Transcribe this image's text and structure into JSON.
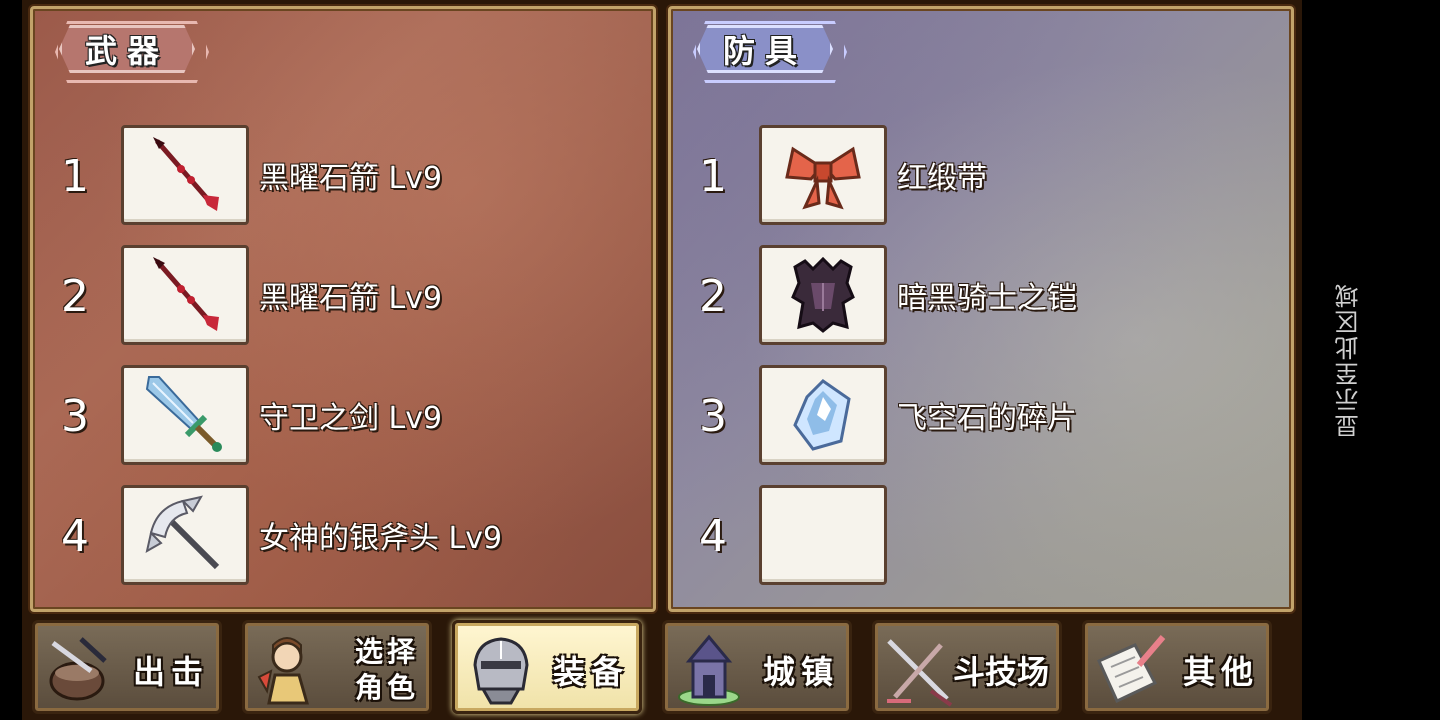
{
  "weapon_panel": {
    "title": "武器",
    "slots": [
      {
        "num": "1",
        "name": "黑曜石箭 Lv9",
        "icon": "obsidian-arrow-icon"
      },
      {
        "num": "2",
        "name": "黑曜石箭 Lv9",
        "icon": "obsidian-arrow-icon"
      },
      {
        "num": "3",
        "name": "守卫之剑 Lv9",
        "icon": "guardian-sword-icon"
      },
      {
        "num": "4",
        "name": "女神的银斧头 Lv9",
        "icon": "silver-axe-icon"
      }
    ]
  },
  "armor_panel": {
    "title": "防具",
    "slots": [
      {
        "num": "1",
        "name": "红缎带",
        "icon": "red-ribbon-icon"
      },
      {
        "num": "2",
        "name": "暗黑骑士之铠",
        "icon": "dark-knight-armor-icon"
      },
      {
        "num": "3",
        "name": "飞空石的碎片",
        "icon": "airstone-shard-icon"
      },
      {
        "num": "4",
        "name": "",
        "icon": "empty-slot"
      }
    ]
  },
  "menu": [
    {
      "label": "出击",
      "icon": "sortie-bowl-icon"
    },
    {
      "label_line1": "选择",
      "label_line2": "角色",
      "icon": "character-select-icon"
    },
    {
      "label": "装备",
      "icon": "equipment-helmet-icon",
      "active": true
    },
    {
      "label": "城镇",
      "icon": "town-tower-icon"
    },
    {
      "label": "斗技场",
      "icon": "arena-swords-icon"
    },
    {
      "label": "其他",
      "icon": "other-paper-icon"
    }
  ],
  "side_hint": "显示至此区域",
  "colors": {
    "weapon_bg": "#a06050",
    "armor_bg": "#8c88a0",
    "active_menu": "#f6eab8"
  }
}
